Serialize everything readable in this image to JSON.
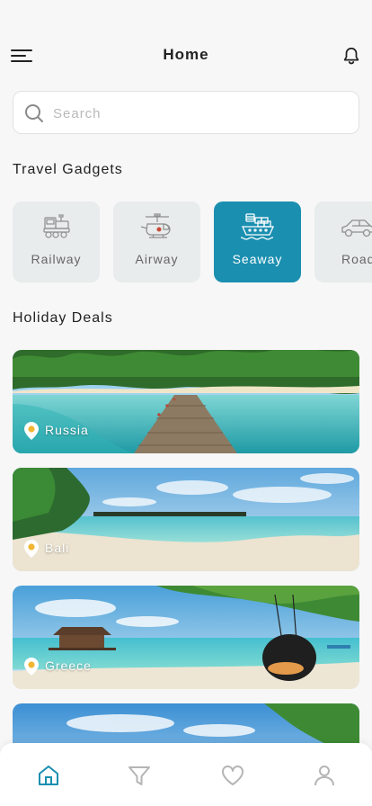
{
  "header": {
    "title": "Home",
    "menu_icon": "hamburger-menu-icon",
    "notification_icon": "bell-icon"
  },
  "search": {
    "placeholder": "Search",
    "value": "",
    "icon": "search-icon"
  },
  "gadgets": {
    "title": "Travel Gadgets",
    "items": [
      {
        "label": "Railway",
        "icon": "train-icon",
        "active": false
      },
      {
        "label": "Airway",
        "icon": "helicopter-icon",
        "active": false
      },
      {
        "label": "Seaway",
        "icon": "ship-icon",
        "active": true
      },
      {
        "label": "Road",
        "icon": "car-icon",
        "active": false
      }
    ]
  },
  "deals": {
    "title": "Holiday Deals",
    "items": [
      {
        "location": "Russia"
      },
      {
        "location": "Bali"
      },
      {
        "location": "Greece"
      },
      {
        "location": ""
      }
    ]
  },
  "bottom_nav": {
    "items": [
      {
        "icon": "home-icon",
        "active": true
      },
      {
        "icon": "filter-icon",
        "active": false
      },
      {
        "icon": "heart-icon",
        "active": false
      },
      {
        "icon": "profile-icon",
        "active": false
      }
    ]
  },
  "colors": {
    "accent": "#1a8fb0",
    "background": "#f7f7f7",
    "card_inactive": "#e8ecec",
    "pin": "#f2b632"
  }
}
